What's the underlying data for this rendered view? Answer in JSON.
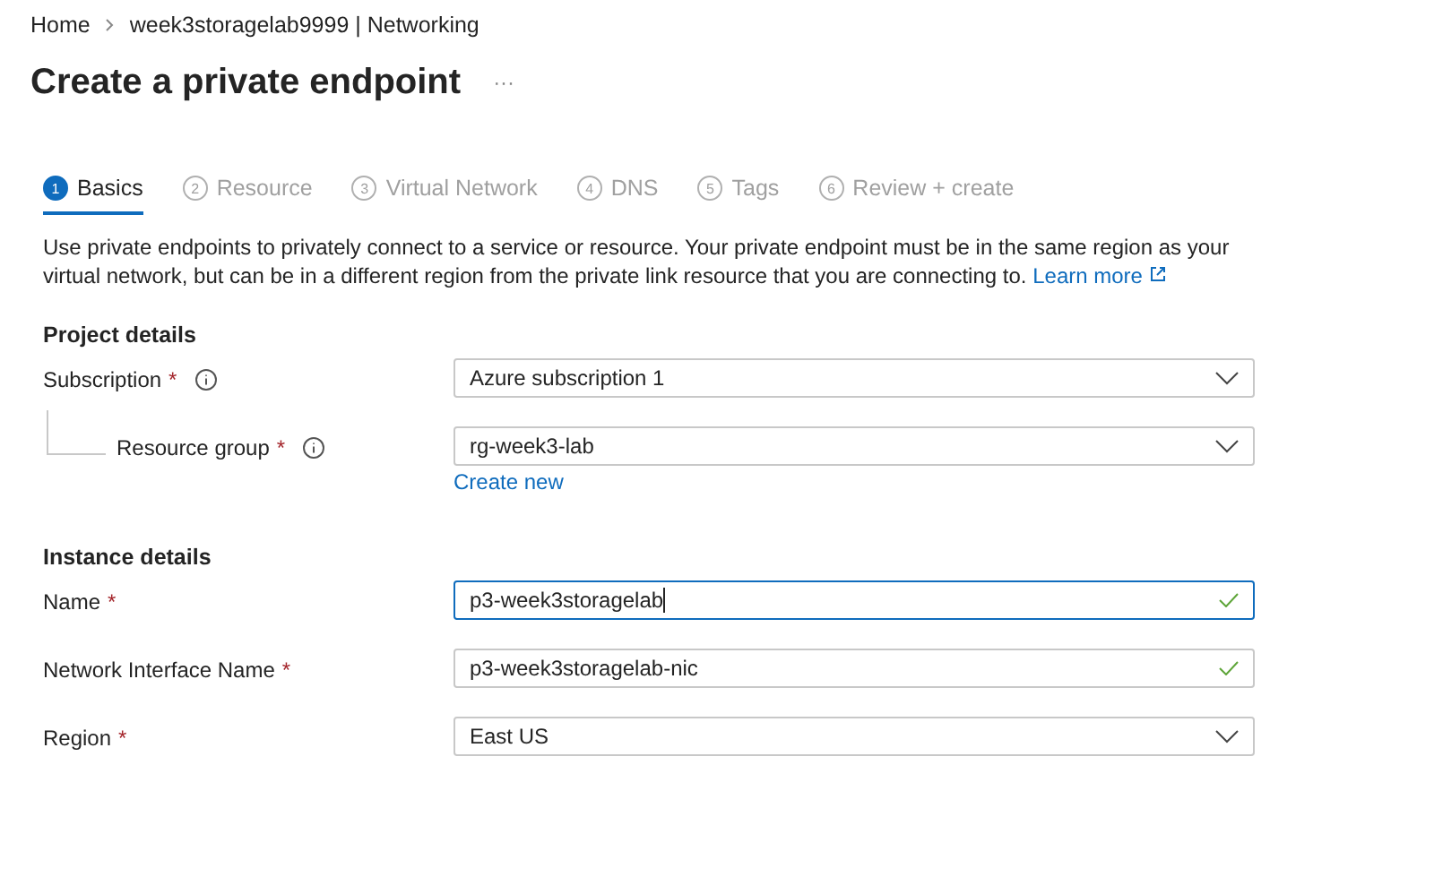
{
  "breadcrumb": [
    "Home",
    "week3storagelab9999 | Networking"
  ],
  "title": "Create a private endpoint",
  "more": "···",
  "tabs": [
    {
      "number": "1",
      "label": "Basics",
      "selected": true
    },
    {
      "number": "2",
      "label": "Resource",
      "selected": false
    },
    {
      "number": "3",
      "label": "Virtual Network",
      "selected": false
    },
    {
      "number": "4",
      "label": "DNS",
      "selected": false
    },
    {
      "number": "5",
      "label": "Tags",
      "selected": false
    },
    {
      "number": "6",
      "label": "Review + create",
      "selected": false
    }
  ],
  "description": "Use private endpoints to privately connect to a service or resource. Your private endpoint must be in the same region as your virtual network, but can be in a different region from the private link resource that you are connecting to.",
  "learn_more": "Learn more",
  "sections": [
    {
      "heading": "Project details",
      "fields": [
        {
          "label": "Subscription",
          "required": "*",
          "info": true,
          "nested": false,
          "kind": "dropdown",
          "value": "Azure subscription 1",
          "focused": false,
          "valid": false
        },
        {
          "label": "Resource group",
          "required": "*",
          "info": true,
          "nested": true,
          "kind": "dropdown",
          "value": "rg-week3-lab",
          "focused": false,
          "valid": false,
          "link": "Create new"
        }
      ]
    },
    {
      "heading": "Instance details",
      "fields": [
        {
          "label": "Name",
          "required": "*",
          "info": false,
          "nested": false,
          "kind": "text",
          "value": "p3-week3storagelab",
          "focused": true,
          "valid": true
        },
        {
          "label": "Network Interface Name",
          "required": "*",
          "info": false,
          "nested": false,
          "kind": "text",
          "value": "p3-week3storagelab-nic",
          "focused": false,
          "valid": true
        },
        {
          "label": "Region",
          "required": "*",
          "info": false,
          "nested": false,
          "kind": "dropdown",
          "value": "East US",
          "focused": false,
          "valid": false
        }
      ]
    }
  ]
}
